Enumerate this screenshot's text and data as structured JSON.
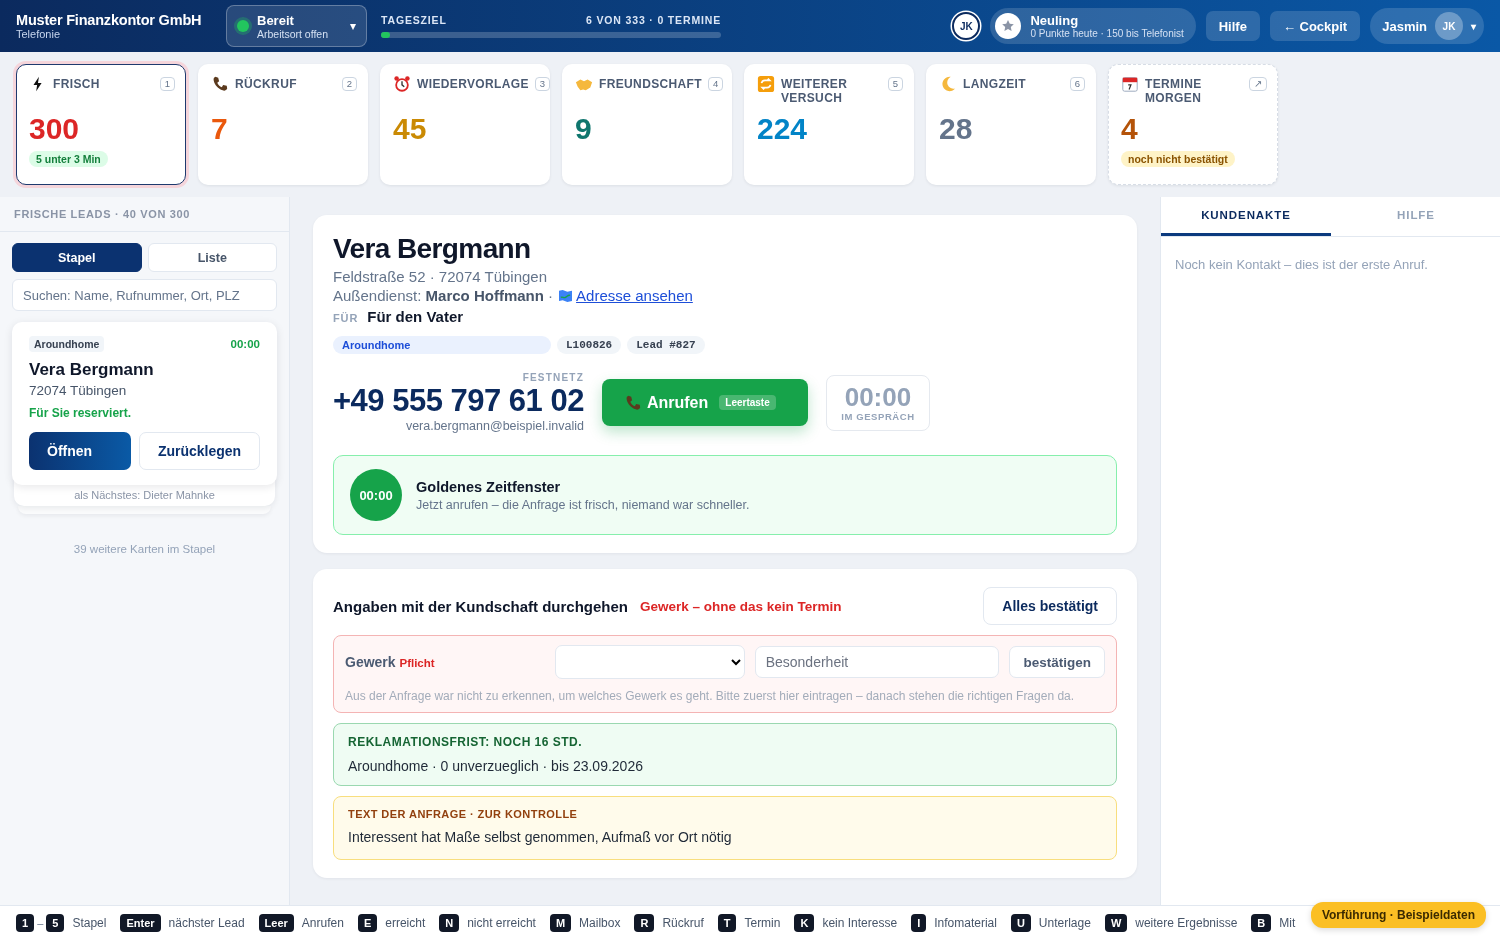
{
  "header": {
    "brand": "Muster Finanzkontor GmbH",
    "subtitle": "Telefonie",
    "status": {
      "label": "Bereit",
      "detail": "Arbeitsort offen",
      "online": true,
      "caret": "▾"
    },
    "goal": {
      "label": "TAGESZIEL",
      "reading": "6 VON 333 · 0 TERMINE",
      "level": 0.02
    },
    "initials": "JK",
    "rank": {
      "title": "Neuling",
      "detail": "0 Punkte heute · 150 bis Telefonist"
    },
    "buttons": [
      "Hilfe",
      "← Cockpit"
    ],
    "user": {
      "name": "Jasmin",
      "initials": "JK",
      "caret": "▾"
    }
  },
  "tiles": [
    {
      "kind": "queue",
      "label": "FRISCH",
      "badge": "1",
      "count": "300",
      "color": "#dc2626",
      "selected": true,
      "note": {
        "text": "5 unter 3 Min",
        "kind": "success"
      }
    },
    {
      "kind": "queue",
      "label": "RÜCKRUF",
      "badge": "2",
      "count": "7",
      "color": "#ea580c",
      "selected": false
    },
    {
      "kind": "queue",
      "label": "WIEDERVORLAGE",
      "badge": "3",
      "count": "45",
      "color": "#ca8a04",
      "selected": false
    },
    {
      "kind": "queue",
      "label": "FREUNDSCHAFT",
      "badge": "4",
      "count": "9",
      "color": "#0f766e",
      "selected": false
    },
    {
      "kind": "queue",
      "label": "WEITERER VERSUCH",
      "badge": "5",
      "count": "224",
      "color": "#0284c7",
      "selected": false
    },
    {
      "kind": "queue",
      "label": "LANGZEIT",
      "badge": "6",
      "count": "28",
      "color": "#64748b",
      "selected": false
    },
    {
      "kind": "link",
      "label": "TERMINE MORGEN",
      "badge": "↗",
      "count": "4",
      "color": "#b45309",
      "selected": false,
      "note": {
        "text": "noch nicht bestätigt",
        "kind": "warning"
      }
    }
  ],
  "sidebar": {
    "heading": "FRISCHE LEADS · 40 VON 300",
    "tabs": [
      {
        "label": "Stapel",
        "selected": true
      },
      {
        "label": "Liste",
        "selected": false
      }
    ],
    "search": {
      "placeholder": "Suchen: Name, Rufnummer, Ort, PLZ"
    },
    "card": {
      "source": "Aroundhome",
      "timer": "00:00",
      "name": "Vera Bergmann",
      "city": "72074 Tübingen",
      "reserved": "Für Sie reserviert.",
      "buttons": [
        "Öffnen",
        "Zurücklegen"
      ]
    },
    "next": "als Nächstes: Dieter Mahnke",
    "remaining": "39 weitere Karten im Stapel"
  },
  "contact": {
    "name": "Vera Bergmann",
    "address": "Feldstraße 52 · 72074 Tübingen",
    "field_rep": "Außendienst: **Marco Hoffmann** ·",
    "map_link": "Adresse ansehen",
    "for_label": "FÜR",
    "for_value": "Für den Vater",
    "tags": [
      {
        "kind": "brand",
        "text": "Aroundhome"
      },
      {
        "kind": "code",
        "text": "L100826"
      },
      {
        "kind": "code",
        "text": "Lead #827"
      }
    ],
    "phone_type": "FESTNETZ",
    "phone": "+49 555 797 61 02",
    "email": "vera.bergmann@beispiel.invalid",
    "call_button": {
      "label": "Anrufen",
      "shortcut": "Leertaste"
    },
    "call_timer": {
      "time": "00:00",
      "label": "IM GESPRÄCH"
    },
    "golden": {
      "time": "00:00",
      "title": "Goldenes Zeitfenster",
      "text": "Jetzt anrufen – die Anfrage ist frisch, niemand war schneller."
    }
  },
  "checklist": {
    "title": "Angaben mit der Kundschaft durchgehen",
    "warning": "Gewerk – ohne das kein Termin",
    "confirm_all": "Alles bestätigt",
    "trade": {
      "label": "Gewerk",
      "required": "Pflicht",
      "placeholder": "Besonderheit",
      "confirm": "bestätigen",
      "hint": "Aus der Anfrage war nicht zu erkennen, um welches Gewerk es geht. Bitte zuerst hier eintragen – danach stehen die richtigen Fragen da."
    },
    "notices": [
      {
        "kind": "success",
        "title": "REKLAMATIONSFRIST: NOCH 16 STD.",
        "text": "Aroundhome · 0 unverzueglich · bis 23.09.2026"
      },
      {
        "kind": "warning",
        "title": "TEXT DER ANFRAGE · ZUR KONTROLLE",
        "text": "Interessent hat Maße selbst genommen, Aufmaß vor Ort nötig"
      }
    ]
  },
  "right_panel": {
    "tabs": [
      {
        "label": "KUNDENAKTE",
        "selected": true
      },
      {
        "label": "HILFE",
        "selected": false
      }
    ],
    "text": "Noch kein Kontakt – dies ist der erste Anruf."
  },
  "shortcuts": [
    {
      "keys": [
        "1",
        "5"
      ],
      "joiner": "–",
      "label": "Stapel"
    },
    {
      "keys": [
        "Enter"
      ],
      "label": "nächster Lead"
    },
    {
      "keys": [
        "Leer"
      ],
      "label": "Anrufen"
    },
    {
      "keys": [
        "E"
      ],
      "label": "erreicht"
    },
    {
      "keys": [
        "N"
      ],
      "label": "nicht erreicht"
    },
    {
      "keys": [
        "M"
      ],
      "label": "Mailbox"
    },
    {
      "keys": [
        "R"
      ],
      "label": "Rückruf"
    },
    {
      "keys": [
        "T"
      ],
      "label": "Termin"
    },
    {
      "keys": [
        "K"
      ],
      "label": "kein Interesse"
    },
    {
      "keys": [
        "I"
      ],
      "label": "Infomaterial"
    },
    {
      "keys": [
        "U"
      ],
      "label": "Unterlage"
    },
    {
      "keys": [
        "W"
      ],
      "label": "weitere Ergebnisse"
    },
    {
      "keys": [
        "B"
      ],
      "label": "Mit"
    }
  ],
  "demo_badge": "Vorführung · Beispieldaten"
}
